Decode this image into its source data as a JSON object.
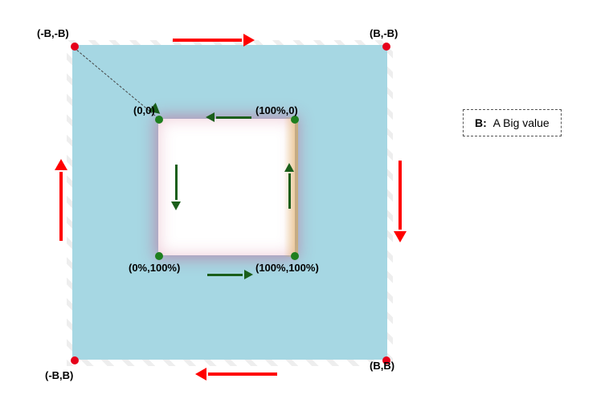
{
  "labels": {
    "outer_tl": "(-B,-B)",
    "outer_tr": "(B,-B)",
    "outer_bl": "(-B,B)",
    "outer_br": "(B,B)",
    "inner_tl": "(0,0)",
    "inner_tr": "(100%,0)",
    "inner_bl": "(0%,100%)",
    "inner_br": "(100%,100%)"
  },
  "legend": {
    "key": "B:",
    "value": "A Big value"
  },
  "colors": {
    "outer_fill": "#a6d7e3",
    "outer_dot": "#e6001a",
    "inner_dot": "#1e7f1e",
    "outer_arrow": "#ff0000",
    "inner_arrow": "#1a5e1a"
  },
  "chart_data": {
    "type": "diagram",
    "title": "Outer and inner box path traversal",
    "outer_box": {
      "corners": [
        "(-B,-B)",
        "(B,-B)",
        "(B,B)",
        "(-B,B)"
      ],
      "traversal_direction": "clockwise",
      "arrow_color": "red",
      "corner_marker_color": "red"
    },
    "inner_box": {
      "corners": [
        "(0,0)",
        "(100%,0)",
        "(100%,100%)",
        "(0%,100%)"
      ],
      "traversal_direction": "counter-clockwise",
      "arrow_color": "dark-green",
      "corner_marker_color": "green",
      "note": "diagonal dashed connector from outer (-B,-B) to inner (0,0) with green arrowhead"
    },
    "legend": {
      "B": "A Big value"
    }
  }
}
